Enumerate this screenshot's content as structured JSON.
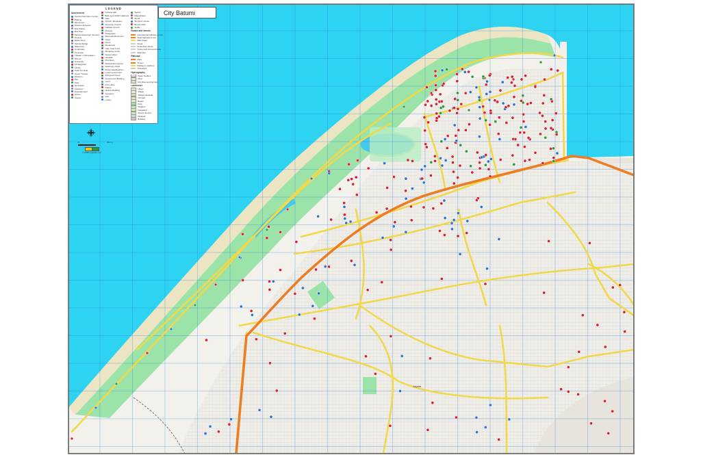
{
  "map": {
    "title": "City Batumi",
    "legend_title": "LEGEND",
    "district_label": "Jagata",
    "scale_start": "0",
    "scale_end": "250 m",
    "copyright": "© 2015 Graphicx Inc.",
    "colors": {
      "sea": "#2fd3f2",
      "land": "#f2f1ec",
      "beach": "#ece5c4",
      "park": "#9be3a8",
      "lake": "#46c8ec",
      "major_road": "#f1d84a",
      "highway": "#ec7d24",
      "grid": "#1e6fd8",
      "poi_red": "#d62230",
      "poi_blue": "#2c74d1",
      "poi_green": "#2b9a3e"
    }
  },
  "legend": {
    "col1_heading": "Amusement",
    "col1": [
      "Tourist information Center",
      "Parking",
      "Monument",
      "Pastime Entrance",
      "Bus Station",
      "Bus Stop",
      "Marine Passenger Terminal",
      "Hostels",
      "Bottle Shop",
      "Vehicle Bridge",
      "Waterfront",
      "Underpass",
      "Concorde",
      "Theater / Chill Garden",
      "School",
      "University",
      "Kindergarten",
      "Library",
      "Cash Terminal",
      "Green Theater",
      "Museum",
      "Zoo",
      "Park",
      "Horizontal",
      "Aquarium",
      "Entertainment",
      "Circus",
      "Casino"
    ],
    "col2": [
      "Cultural Hall",
      "Billie-type Arabic Hallmark",
      "Cafe",
      "Church, Monastery",
      "Armenian Church",
      "Catholic Church",
      "Mosque",
      "Synagogue",
      "Memorial Monument",
      "Tower",
      "Dome",
      "Restaurant",
      "Cafe, Fast Food",
      "Shopping center",
      "Supermarket",
      "Hospital",
      "Pharmacy",
      "Medical Emergency",
      "Veterinary Clinic",
      "Police Headquarters",
      "Local Government",
      "Self-government",
      "Government Building",
      "Court",
      "Post office",
      "Palace",
      "Historic Building",
      "Cemetery",
      "Gas",
      "Lottery"
    ],
    "col3_top": [
      "Sauna",
      "Marketplace",
      "Ski lift",
      "Ski Sport Center",
      "Bicycle Path",
      "Stable"
    ],
    "col3_roads_heading": "Roads and streets",
    "col3_roads": [
      "International highway in City",
      "State highway in City",
      "Main Road",
      "Street",
      "Pedestrian Street",
      "Tunnel and Access Roads",
      "Staircase"
    ],
    "col3_rail_heading": "Railroad",
    "col3_rail": [
      "Main",
      "Tunnel",
      "Railway in Harbour",
      "Tramways"
    ],
    "col3_hydro_heading": "Hydrography",
    "col3_hydro": [
      "Water Surface",
      "River",
      "Dry River and Springs"
    ],
    "col3_land_heading": "Landcover",
    "col3_land": [
      "Urban",
      "Village",
      "Village industrial",
      "Orchard",
      "Beach",
      "Park",
      "Stadium",
      "Grassland",
      "Sports Ground",
      "Wetland",
      "Building"
    ]
  }
}
